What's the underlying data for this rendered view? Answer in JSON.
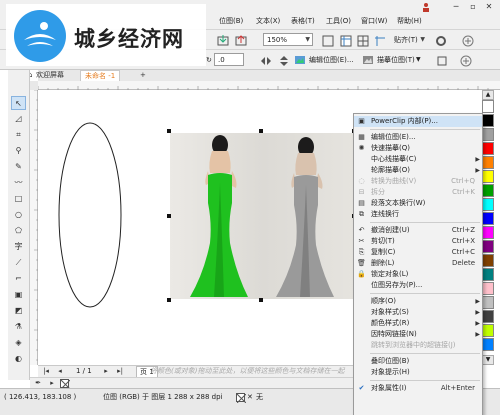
{
  "watermark": {
    "site_name": "城乡经济网"
  },
  "menubar": {
    "items": [
      "位图(B)",
      "文本(X)",
      "表格(T)",
      "工具(O)",
      "窗口(W)",
      "帮助(H)"
    ],
    "user_icon": "user-icon"
  },
  "toolbar": {
    "zoom_value": "150%",
    "snap_label": "贴齐(T)"
  },
  "propbar": {
    "rotation_value": ".0",
    "edit_bitmap_label": "编辑位图(E)...",
    "trace_bitmap_label": "描摹位图(T)"
  },
  "doc_tabs": {
    "welcome": "欢迎屏幕",
    "untitled": "未命名 -1"
  },
  "context_menu": {
    "items": [
      {
        "icon": "powerclip-icon",
        "label": "PowerClip 内部(P)...",
        "shortcut": "",
        "submenu": false,
        "disabled": false,
        "highlighted": true
      },
      {
        "sep": true
      },
      {
        "icon": "edit-bitmap-icon",
        "label": "编辑位图(E)...",
        "shortcut": "",
        "submenu": false,
        "disabled": false
      },
      {
        "icon": "quick-trace-icon",
        "label": "快速描摹(Q)",
        "shortcut": "",
        "submenu": false,
        "disabled": false
      },
      {
        "icon": "",
        "label": "中心线描摹(C)",
        "shortcut": "",
        "submenu": true,
        "disabled": false
      },
      {
        "icon": "",
        "label": "轮廓描摹(O)",
        "shortcut": "",
        "submenu": true,
        "disabled": false
      },
      {
        "icon": "convert-curve-icon",
        "label": "转换为曲线(V)",
        "shortcut": "Ctrl+Q",
        "submenu": false,
        "disabled": true
      },
      {
        "icon": "split-icon",
        "label": "拆分",
        "shortcut": "Ctrl+K",
        "submenu": false,
        "disabled": true
      },
      {
        "icon": "paragraph-wrap-icon",
        "label": "段落文本换行(W)",
        "shortcut": "",
        "submenu": false,
        "disabled": false
      },
      {
        "icon": "link-wrap-icon",
        "label": "连线换行",
        "shortcut": "",
        "submenu": false,
        "disabled": false
      },
      {
        "sep": true
      },
      {
        "icon": "undo-icon",
        "label": "撤消创建(U)",
        "shortcut": "Ctrl+Z",
        "submenu": false,
        "disabled": false
      },
      {
        "icon": "cut-icon",
        "label": "剪切(T)",
        "shortcut": "Ctrl+X",
        "submenu": false,
        "disabled": false
      },
      {
        "icon": "copy-icon",
        "label": "复制(C)",
        "shortcut": "Ctrl+C",
        "submenu": false,
        "disabled": false
      },
      {
        "icon": "delete-icon",
        "label": "删除(L)",
        "shortcut": "Delete",
        "submenu": false,
        "disabled": false
      },
      {
        "icon": "lock-icon",
        "label": "锁定对象(L)",
        "shortcut": "",
        "submenu": false,
        "disabled": false
      },
      {
        "icon": "",
        "label": "位图另存为(P)...",
        "shortcut": "",
        "submenu": false,
        "disabled": false
      },
      {
        "sep": true
      },
      {
        "icon": "",
        "label": "顺序(O)",
        "shortcut": "",
        "submenu": true,
        "disabled": false
      },
      {
        "icon": "",
        "label": "对象样式(S)",
        "shortcut": "",
        "submenu": true,
        "disabled": false
      },
      {
        "icon": "",
        "label": "颜色样式(R)",
        "shortcut": "",
        "submenu": true,
        "disabled": false
      },
      {
        "icon": "",
        "label": "因特网链接(N)",
        "shortcut": "",
        "submenu": true,
        "disabled": false
      },
      {
        "icon": "",
        "label": "跳转到浏览器中的超链接(J)",
        "shortcut": "",
        "submenu": false,
        "disabled": true
      },
      {
        "sep": true
      },
      {
        "icon": "",
        "label": "叠印位图(B)",
        "shortcut": "",
        "submenu": false,
        "disabled": false
      },
      {
        "icon": "",
        "label": "对象提示(H)",
        "shortcut": "",
        "submenu": false,
        "disabled": false
      },
      {
        "sep": true
      },
      {
        "icon": "check-icon",
        "label": "对象属性(I)",
        "shortcut": "Alt+Enter",
        "submenu": false,
        "disabled": false
      }
    ]
  },
  "page_nav": {
    "page_counter": "1 / 1",
    "page_tab": "页 1",
    "hint": "将颜色(或对象)拖动至此处，以便将这些颜色与文档存储在一起"
  },
  "status": {
    "coordinates": "( 126.413, 183.108 )",
    "object_info": "位图 (RGB) 于 图层 1 288 x 288 dpi",
    "fill_none": "无"
  },
  "palette_colors": [
    "#ffffff",
    "#000000",
    "#a0a0a0",
    "#ff0000",
    "#ff8000",
    "#ffff00",
    "#00a000",
    "#00ffff",
    "#0000ff",
    "#ff00ff",
    "#800080",
    "#804000",
    "#008080",
    "#ffc0cb",
    "#c0c0c0",
    "#404040",
    "#c0ff00",
    "#0080ff"
  ],
  "accent_color": "#2f9be8",
  "dress_colors": {
    "left": "#1fc11f",
    "right": "#9a9a9a"
  }
}
